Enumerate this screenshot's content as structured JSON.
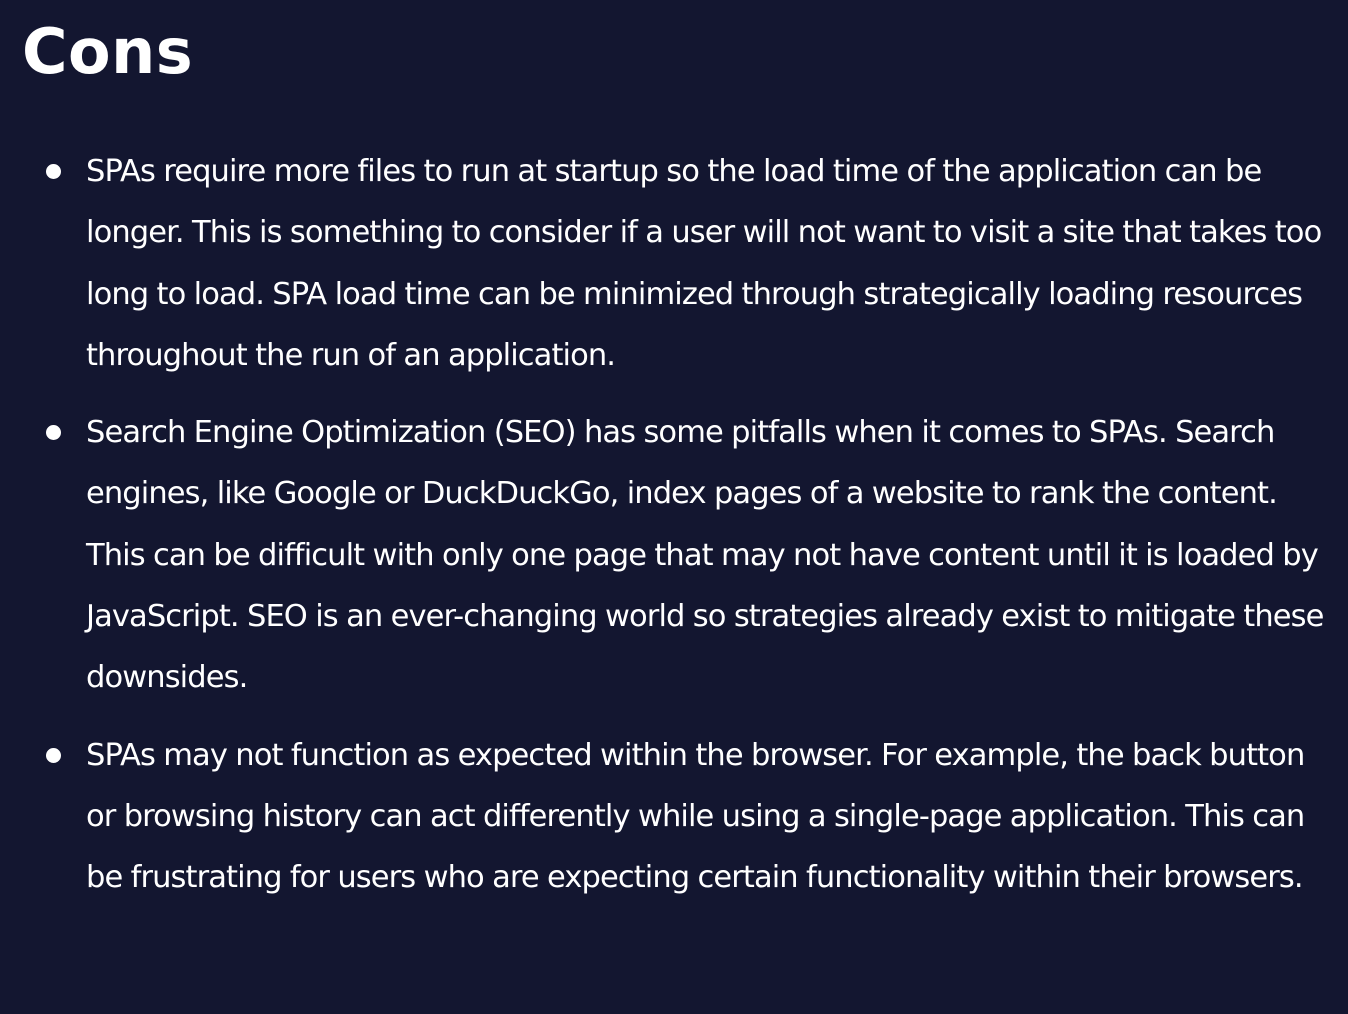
{
  "section": {
    "title": "Cons",
    "items": [
      {
        "text": "SPAs require more files to run at startup so the load time of the application can be longer. This is something to consider if a user will not want to visit a site that takes too long to load. SPA load time can be minimized through strategically loading resources throughout the run of an application."
      },
      {
        "text": "Search Engine Optimization (SEO) has some pitfalls when it comes to SPAs. Search engines, like Google or DuckDuckGo, index pages of a website to rank the content. This can be difficult with only one page that may not have content until it is loaded by JavaScript. SEO is an ever-changing world so strategies already exist to mitigate these downsides."
      },
      {
        "text": "SPAs may not function as expected within the browser. For example, the back button or browsing history can act differently while using a single-page application. This can be frustrating for users who are expecting certain functionality within their browsers."
      }
    ]
  }
}
